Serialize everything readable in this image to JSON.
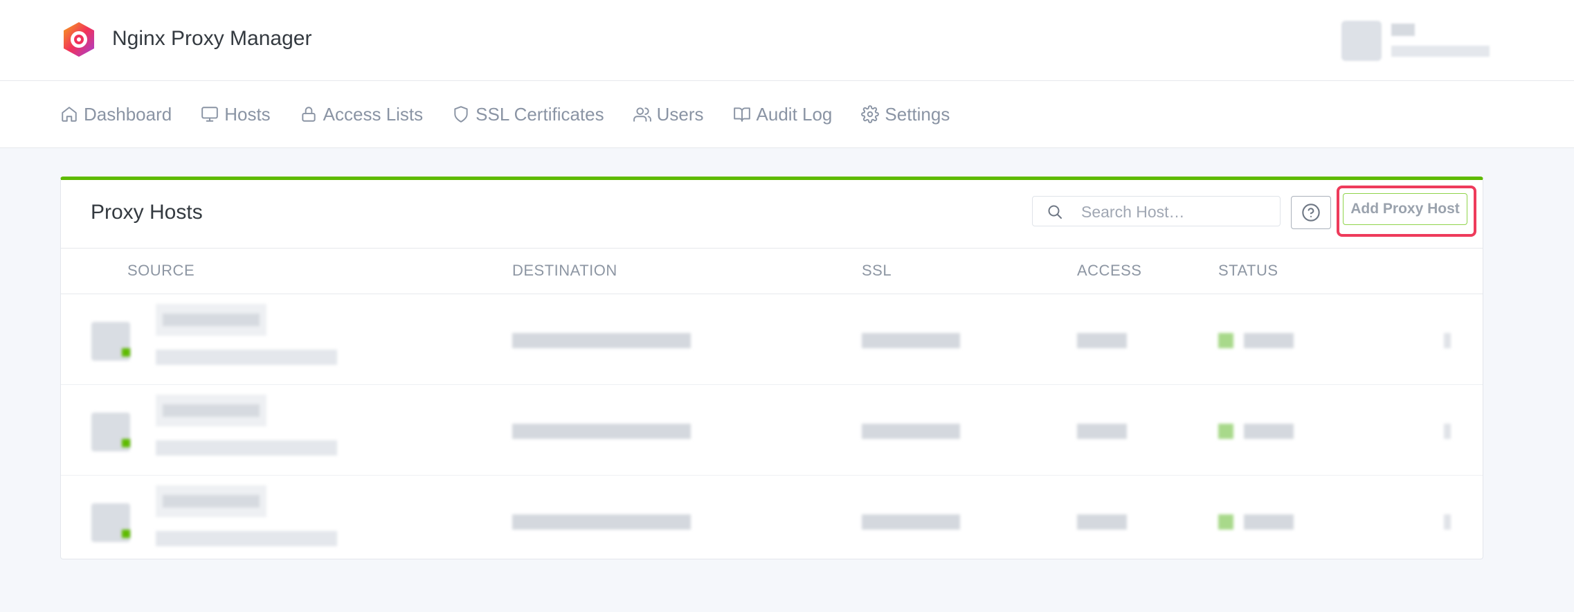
{
  "header": {
    "brand": "Nginx Proxy Manager"
  },
  "nav": {
    "items": [
      {
        "label": "Dashboard",
        "icon": "home-icon"
      },
      {
        "label": "Hosts",
        "icon": "monitor-icon"
      },
      {
        "label": "Access Lists",
        "icon": "lock-icon"
      },
      {
        "label": "SSL Certificates",
        "icon": "shield-icon"
      },
      {
        "label": "Users",
        "icon": "users-icon"
      },
      {
        "label": "Audit Log",
        "icon": "book-icon"
      },
      {
        "label": "Settings",
        "icon": "gear-icon"
      }
    ]
  },
  "card": {
    "title": "Proxy Hosts",
    "search_placeholder": "Search Host…",
    "add_button": "Add Proxy Host",
    "accent_color": "#5eba00",
    "highlight_color": "#ee3b5b"
  },
  "table": {
    "columns": [
      "SOURCE",
      "DESTINATION",
      "SSL",
      "ACCESS",
      "STATUS"
    ]
  }
}
